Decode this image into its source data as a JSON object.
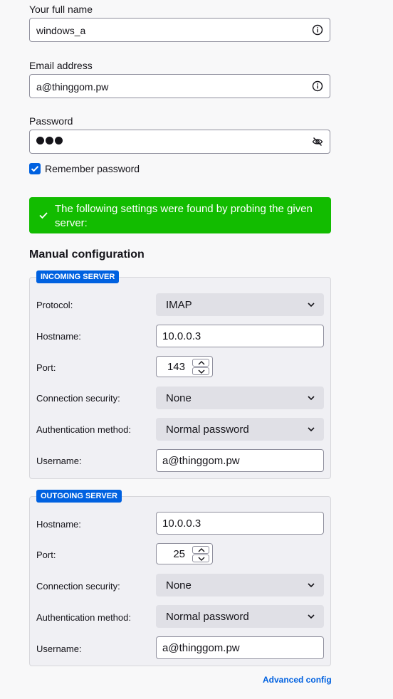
{
  "account": {
    "name_label": "Your full name",
    "name_value": "windows_a",
    "email_label": "Email address",
    "email_value": "a@thinggom.pw",
    "password_label": "Password",
    "remember_label": "Remember password",
    "remember_checked": true
  },
  "banner": {
    "text": "The following settings were found by probing the given server:",
    "color": "#12bc00"
  },
  "manual": {
    "title": "Manual configuration",
    "incoming": {
      "legend": "INCOMING SERVER",
      "protocol_label": "Protocol:",
      "protocol_value": "IMAP",
      "hostname_label": "Hostname:",
      "hostname_value": "10.0.0.3",
      "port_label": "Port:",
      "port_value": "143",
      "security_label": "Connection security:",
      "security_value": "None",
      "auth_label": "Authentication method:",
      "auth_value": "Normal password",
      "username_label": "Username:",
      "username_value": "a@thinggom.pw"
    },
    "outgoing": {
      "legend": "OUTGOING SERVER",
      "hostname_label": "Hostname:",
      "hostname_value": "10.0.0.3",
      "port_label": "Port:",
      "port_value": "25",
      "security_label": "Connection security:",
      "security_value": "None",
      "auth_label": "Authentication method:",
      "auth_value": "Normal password",
      "username_label": "Username:",
      "username_value": "a@thinggom.pw"
    },
    "advanced_label": "Advanced config"
  },
  "colors": {
    "accent": "#0061e0",
    "success": "#12bc00"
  }
}
